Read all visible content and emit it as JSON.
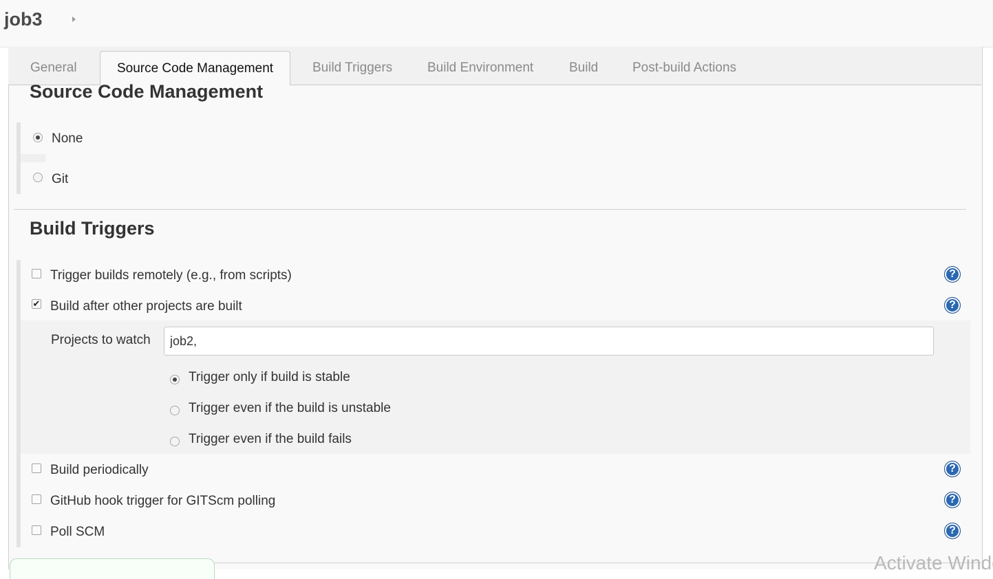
{
  "header": {
    "job_name": "job3"
  },
  "tabs": [
    {
      "label": "General"
    },
    {
      "label": "Source Code Management"
    },
    {
      "label": "Build Triggers"
    },
    {
      "label": "Build Environment"
    },
    {
      "label": "Build"
    },
    {
      "label": "Post-build Actions"
    }
  ],
  "active_tab": "Source Code Management",
  "scm": {
    "title": "Source Code Management",
    "options": [
      {
        "label": "None",
        "selected": true
      },
      {
        "label": "Git",
        "selected": false
      }
    ]
  },
  "build_triggers": {
    "title": "Build Triggers",
    "items": [
      {
        "label": "Trigger builds remotely (e.g., from scripts)",
        "checked": false
      },
      {
        "label": "Build after other projects are built",
        "checked": true
      },
      {
        "label": "Build periodically",
        "checked": false
      },
      {
        "label": "GitHub hook trigger for GITScm polling",
        "checked": false
      },
      {
        "label": "Poll SCM",
        "checked": false
      }
    ],
    "projects_to_watch": {
      "label": "Projects to watch",
      "value": "job2,"
    },
    "threshold_options": [
      {
        "label": "Trigger only if build is stable",
        "selected": true
      },
      {
        "label": "Trigger even if the build is unstable",
        "selected": false
      },
      {
        "label": "Trigger even if the build fails",
        "selected": false
      }
    ]
  },
  "help_icon_glyph": "?",
  "checkmark_glyph": "✔",
  "watermark": "Activate Windows",
  "icons": [
    "breadcrumb-arrow-icon",
    "help-icon"
  ]
}
